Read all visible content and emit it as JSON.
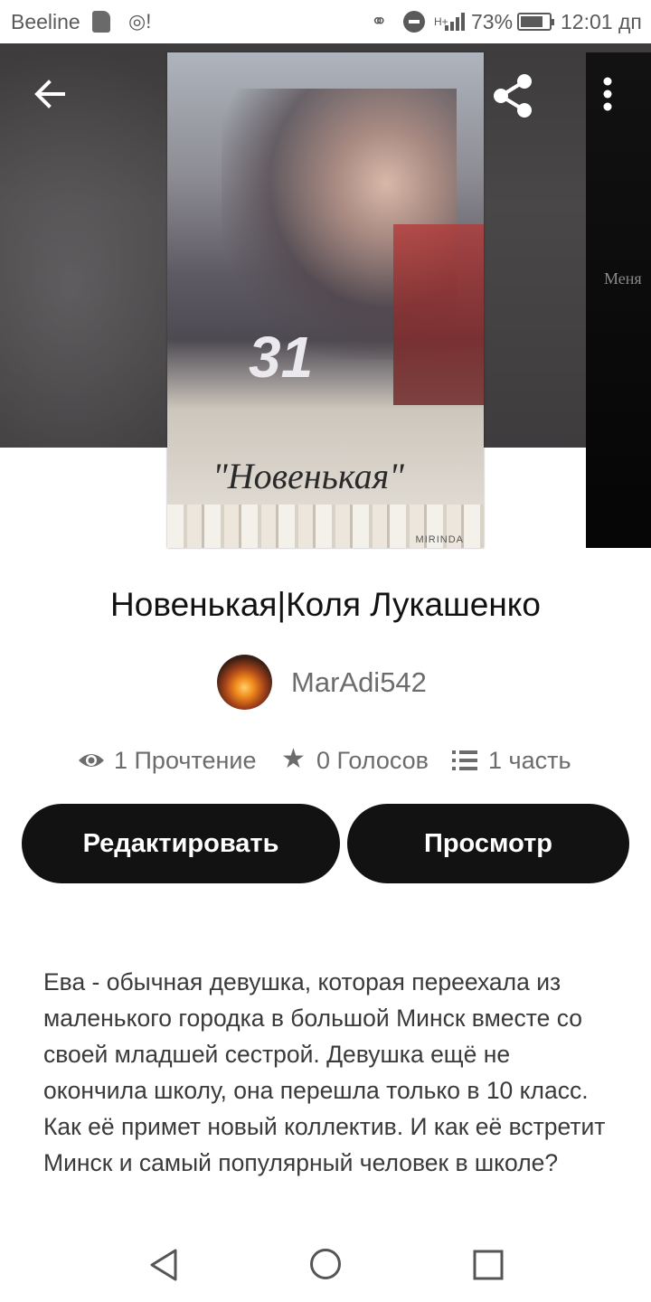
{
  "status_bar": {
    "carrier": "Beeline",
    "signal_type": "H+",
    "battery_percent": "73%",
    "time": "12:01 дп"
  },
  "header": {
    "back_icon": "arrow-left-icon",
    "share_icon": "share-icon",
    "more_icon": "more-vertical-icon"
  },
  "cover": {
    "number": "31",
    "title": "\"Новенькая\"",
    "credit": "MIRINDA",
    "next_cover_text": "Меня"
  },
  "story": {
    "title": "Новенькая|Коля Лукашенко",
    "author": "MarAdi542",
    "stats": {
      "reads": "1 Прочтение",
      "votes": "0 Голосов",
      "parts": "1 часть"
    },
    "edit_label": "Редактировать",
    "preview_label": "Просмотр",
    "description": "Ева - обычная девушка, которая переехала из маленького городка в большой Минск вместе со своей младшей сестрой. Девушка ещё не окончила школу, она перешла только в 10 класс. Как её примет новый коллектив. И как её встретит Минск и самый популярный человек в школе?"
  },
  "colors": {
    "button_bg": "#121212",
    "button_text": "#ffffff",
    "secondary_text": "#6c6c6c"
  }
}
